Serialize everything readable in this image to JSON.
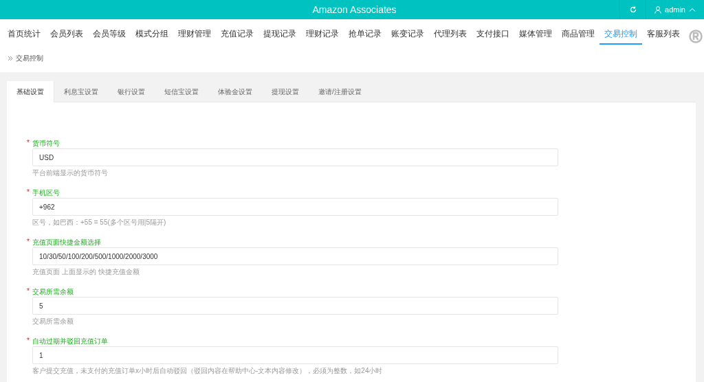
{
  "header": {
    "title": "Amazon Associates",
    "user": "admin"
  },
  "nav": [
    {
      "label": "首页统计",
      "selected": false
    },
    {
      "label": "会员列表",
      "selected": false
    },
    {
      "label": "会员等级",
      "selected": false
    },
    {
      "label": "模式分组",
      "selected": false
    },
    {
      "label": "理财管理",
      "selected": false
    },
    {
      "label": "充值记录",
      "selected": false
    },
    {
      "label": "提现记录",
      "selected": false
    },
    {
      "label": "理财记录",
      "selected": false
    },
    {
      "label": "抢单记录",
      "selected": false
    },
    {
      "label": "账变记录",
      "selected": false
    },
    {
      "label": "代理列表",
      "selected": false
    },
    {
      "label": "支付接口",
      "selected": false
    },
    {
      "label": "媒体管理",
      "selected": false
    },
    {
      "label": "商品管理",
      "selected": false
    },
    {
      "label": "交易控制",
      "selected": true
    },
    {
      "label": "客服列表",
      "selected": false
    }
  ],
  "breadcrumb": "交易控制",
  "tabs": [
    {
      "label": "基础设置",
      "selected": true
    },
    {
      "label": "利息宝设置",
      "selected": false
    },
    {
      "label": "银行设置",
      "selected": false
    },
    {
      "label": "短信宝设置",
      "selected": false
    },
    {
      "label": "体验金设置",
      "selected": false
    },
    {
      "label": "提现设置",
      "selected": false
    },
    {
      "label": "邀请/注册设置",
      "selected": false
    }
  ],
  "fields": [
    {
      "required_mark": "*",
      "label": "货币符号",
      "value": "USD",
      "help": "平台前端显示的货币符号"
    },
    {
      "required_mark": "*",
      "label": "手机区号",
      "value": "+962",
      "help": "区号，如巴西：+55 = 55(多个区号用|5隔开)"
    },
    {
      "required_mark": "*",
      "label": "充值页面快捷金额选择",
      "value": "10/30/50/100/200/500/1000/2000/3000",
      "help": "充值页面 上面显示的 快捷充值金额"
    },
    {
      "required_mark": "*",
      "label": "交易所需余额",
      "value": "5",
      "help": "交易所需余额"
    },
    {
      "required_mark": "*",
      "label": "自动过期并驳回充值订单",
      "value": "1",
      "help": "客户提交充值，未支付的充值订单x小时后自动驳回（驳回内容在帮助中心-文本内容修改），必须为整数，如24小时"
    }
  ]
}
